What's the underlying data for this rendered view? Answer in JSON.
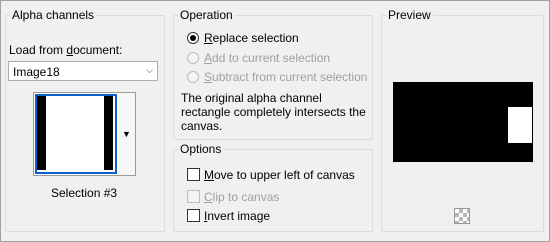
{
  "alpha_channels": {
    "title": "Alpha channels",
    "load_label_pre": "Load from ",
    "load_label_key": "d",
    "load_label_post": "ocument:",
    "document_value": "Image18",
    "selection_name": "Selection #3"
  },
  "operation": {
    "title": "Operation",
    "options": [
      {
        "key": "R",
        "rest": "eplace selection",
        "selected": true,
        "enabled": true
      },
      {
        "key": "A",
        "rest": "dd to current selection",
        "selected": false,
        "enabled": false
      },
      {
        "key": "S",
        "rest": "ubtract from current selection",
        "selected": false,
        "enabled": false
      }
    ],
    "message": "The original alpha channel rectangle completely intersects the canvas."
  },
  "options": {
    "title": "Options",
    "items": [
      {
        "key": "M",
        "rest": "ove to upper left of canvas",
        "checked": false,
        "enabled": true
      },
      {
        "key": "C",
        "rest": "lip to canvas",
        "checked": false,
        "enabled": false
      },
      {
        "key": "I",
        "rest": "nvert image",
        "checked": false,
        "enabled": true
      }
    ]
  },
  "preview": {
    "title": "Preview",
    "transparency_icon": "checkerboard-icon"
  },
  "colors": {
    "selection_border": "#0a64c8",
    "disabled_text": "#a0a0a0"
  }
}
